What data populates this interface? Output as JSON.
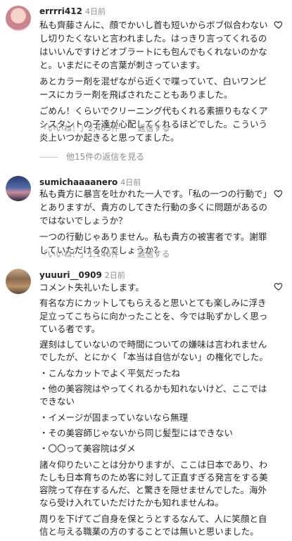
{
  "comments": [
    {
      "username": "errrri412",
      "time": "4日前",
      "paragraphs": [
        "私も齊藤さんに、顔でかいし首も短いからボブ似合わないし切りたくないと言われました。はっきり言ってくれるのはいいんですけどオブラートにも包んでもくれないのかなと。いまだにその言葉が刺さっています。",
        "あとカラー剤を混ぜながら近くで喋っていて、白いワンピースにカラー剤を飛ばされたこともありました。",
        "ごめん！くらいでクリーニング代もくれる素振りもなくアシスタントの子達が心配してくれるほどでした。こういう炎上いつか起きると思ってました。"
      ],
      "likes": "「いいね！」2,405件",
      "reply_label": "返信する",
      "more_replies": "他15件の返信を見る"
    },
    {
      "username": "sumichaaaanero",
      "time": "4日前",
      "paragraphs": [
        "私も貴方に暴言を吐かれた一人です。「私の一つの行動で」とありますが、貴方のしてきた行動の多くに問題があるのではないでしょうか？",
        "一つの行動じゃありません。私も貴方の被害者です。謝罪していただけるのでしょうか？"
      ],
      "likes": "「いいね！」1,146件",
      "reply_label": "返信する"
    },
    {
      "username": "yuuuri__0909",
      "time": "2日前",
      "paragraphs": [
        "コメント失礼いたします。",
        "有名な方にカットしてもらえると思いとても楽しみに浮き足立ってこちらに向かったことを、今では恥ずかしく思っている者です。",
        "遅刻はしていないので時間についての嫌味は言われませんでしたが、とにかく「本当は自信がない」の権化でした。",
        "・こんなカットでよく平気だったね",
        "・他の美容院はやってくれるかも知れないけど、ここではできない",
        "・イメージが固まっていないなら無理",
        "・その美容師じゃないから同じ髪型にはできない",
        "・〇〇って美容院はダメ",
        "諸々仰りたいことは分かりますが、ここは日本であり、わたしも日本育ちのため客に対して正直すぎる発言をする美容院って存在するんだ、と驚きを隠せませんでした。海外なら受け入れていただけたかも知れませんね。",
        "周りを下げてご自身を保とうとするなんて、人に笑顔と自信と与える職業の方のすることでは無いと思いました。"
      ]
    }
  ]
}
